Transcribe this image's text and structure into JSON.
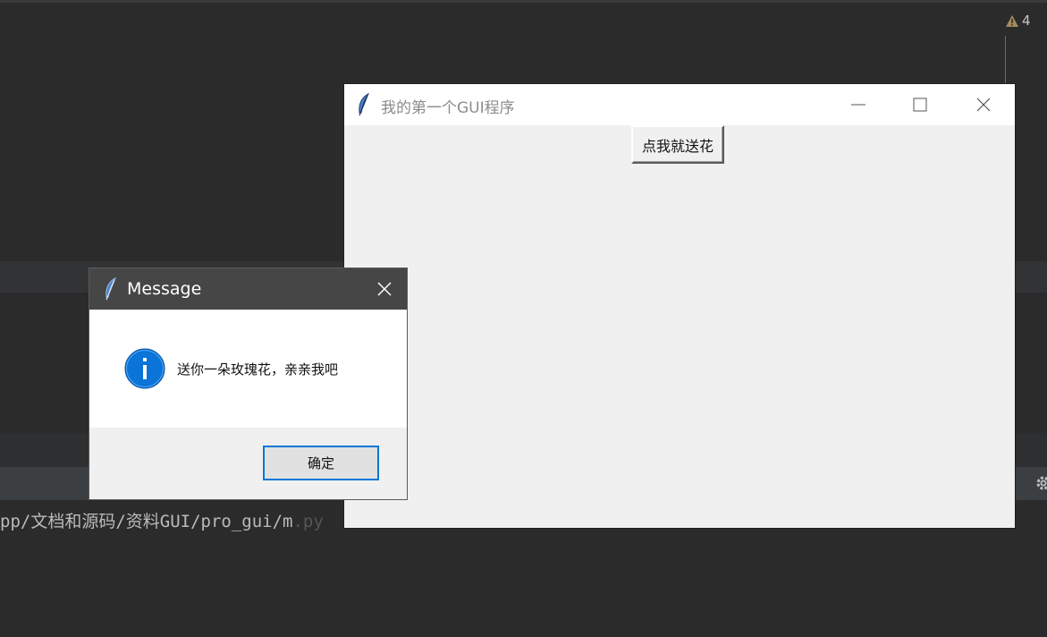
{
  "ide": {
    "warning_count": "4",
    "console_path": "pp/文档和源码/资料GUI/pro_gui/m",
    "console_tail": ".py"
  },
  "main_window": {
    "title": "我的第一个GUI程序",
    "button_label": "点我就送花",
    "icons": {
      "app": "feather-icon",
      "minimize": "minimize-icon",
      "maximize": "maximize-icon",
      "close": "close-icon"
    }
  },
  "message_dialog": {
    "title": "Message",
    "message": "送你一朵玫瑰花，亲亲我吧",
    "ok_label": "确定",
    "icon": "info-icon",
    "colors": {
      "info": "#0a74d8",
      "focus": "#0078d7"
    }
  }
}
